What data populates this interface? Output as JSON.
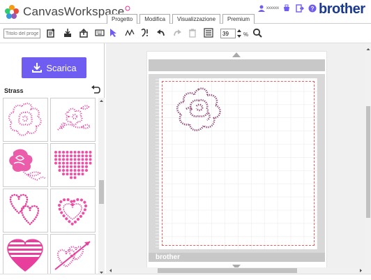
{
  "app": {
    "name": "CanvasWorkspace",
    "brand": "brother"
  },
  "header": {
    "tabs": [
      {
        "label": "Progetto"
      },
      {
        "label": "Modifica"
      },
      {
        "label": "Visualizzazione"
      },
      {
        "label": "Premium"
      }
    ],
    "user_name": "xxxxxx"
  },
  "toolbar": {
    "title_placeholder": "Titolo del progetto",
    "zoom_value": "39",
    "zoom_unit": "%"
  },
  "left_panel": {
    "download_label": "Scarica",
    "category_title": "Strass",
    "patterns": [
      {
        "name": "flower-rose"
      },
      {
        "name": "flower-sprig"
      },
      {
        "name": "rose-stem"
      },
      {
        "name": "heart-dots"
      },
      {
        "name": "double-hearts"
      },
      {
        "name": "heart-outline"
      },
      {
        "name": "striped-heart"
      },
      {
        "name": "hearts-arrow"
      }
    ]
  },
  "workspace": {
    "mat_brand": "brother"
  },
  "colors": {
    "accent": "#6f5cf0",
    "rhinestone_pink": "#e83f9c",
    "rhinestone_purple": "#8a3d6e",
    "brand_blue": "#1a3a8f"
  }
}
